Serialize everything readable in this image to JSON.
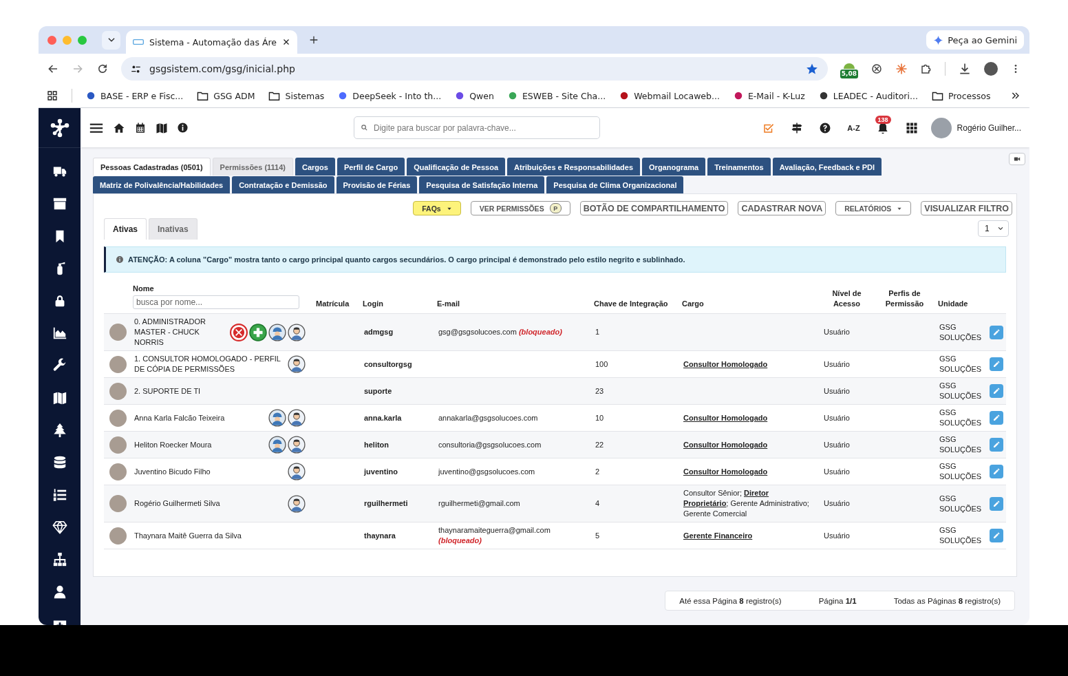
{
  "browser": {
    "tab_title": "Sistema - Automação das Áre",
    "gemini_button": "Peça ao Gemini",
    "url": "gsgsistem.com/gsg/inicial.php",
    "extension_badge": "5,08",
    "bookmarks": [
      {
        "label": "BASE - ERP e Fisc...",
        "kind": "site",
        "color": "#2b59c3"
      },
      {
        "label": "GSG ADM",
        "kind": "folder"
      },
      {
        "label": "Sistemas",
        "kind": "folder"
      },
      {
        "label": "DeepSeek - Into th...",
        "kind": "site",
        "color": "#4d6bfe"
      },
      {
        "label": "Qwen",
        "kind": "site",
        "color": "#6b4ce6"
      },
      {
        "label": "ESWEB - Site Cha...",
        "kind": "site",
        "color": "#3aa757"
      },
      {
        "label": "Webmail Locaweb...",
        "kind": "site",
        "color": "#b5121b"
      },
      {
        "label": "E-Mail - K-Luz",
        "kind": "site",
        "color": "#c2185b"
      },
      {
        "label": "LEADEC - Auditori...",
        "kind": "site",
        "color": "#333333"
      },
      {
        "label": "Processos",
        "kind": "folder"
      }
    ]
  },
  "header": {
    "search_placeholder": "Digite para buscar por palavra-chave...",
    "shortcut": "A-Z",
    "notifications": "138",
    "user_name": "Rogério Guilher..."
  },
  "tab_rows": [
    [
      {
        "label": "Pessoas Cadastradas  (0501)",
        "kind": "light",
        "selected": true
      },
      {
        "label": "Permissões (1114)",
        "kind": "light",
        "selected": false
      },
      {
        "label": "Cargos",
        "kind": "dark",
        "selected": false
      },
      {
        "label": "Perfil de Cargo",
        "kind": "dark",
        "selected": false
      },
      {
        "label": "Qualificação de Pessoa",
        "kind": "dark",
        "selected": false
      },
      {
        "label": "Atribuições e Responsabilidades",
        "kind": "dark",
        "selected": false
      },
      {
        "label": "Organograma",
        "kind": "dark",
        "selected": false
      },
      {
        "label": "Treinamentos",
        "kind": "dark",
        "selected": false
      },
      {
        "label": "Avaliação, Feedback e PDI",
        "kind": "dark",
        "selected": false
      }
    ],
    [
      {
        "label": "Matriz de Polivalência/Habilidades",
        "kind": "dark",
        "selected": false
      },
      {
        "label": "Contratação e Demissão",
        "kind": "dark",
        "selected": false
      },
      {
        "label": "Provisão de Férias",
        "kind": "dark",
        "selected": false
      },
      {
        "label": "Pesquisa de Satisfação Interna",
        "kind": "dark",
        "selected": false
      },
      {
        "label": "Pesquisa de Clima Organizacional",
        "kind": "dark",
        "selected": false
      }
    ]
  ],
  "actions": [
    {
      "label": "FAQs",
      "kind": "faq"
    },
    {
      "label": "VER PERMISSÕES",
      "kind": "permissions",
      "badge": "P"
    },
    {
      "label": "BOTÃO DE COMPARTILHAMENTO",
      "kind": "plain"
    },
    {
      "label": "CADASTRAR NOVA",
      "kind": "plain"
    },
    {
      "label": "RELATÓRIOS",
      "kind": "menu"
    },
    {
      "label": "VISUALIZAR FILTRO",
      "kind": "plain"
    }
  ],
  "status_tabs": [
    {
      "label": "Ativas",
      "selected": true
    },
    {
      "label": "Inativas",
      "selected": false
    }
  ],
  "page_select": "1",
  "notice": "ATENÇÃO: A coluna \"Cargo\" mostra tanto o cargo principal quanto cargos secundários. O cargo principal é demonstrado pelo estilo negrito e sublinhado.",
  "table": {
    "name_filter_placeholder": "busca por nome...",
    "columns": [
      "Nome",
      "Matrícula",
      "Login",
      "E-mail",
      "Chave de Integração",
      "Cargo",
      "Nível de Acesso",
      "Perfis de Permissão",
      "Unidade"
    ],
    "rows": [
      {
        "name": "0. ADMINISTRADOR MASTER - CHUCK NORRIS",
        "badges": [
          {
            "kind": "brigade"
          },
          {
            "kind": "first-aid"
          },
          {
            "kind": "engineer"
          },
          {
            "kind": "consultant"
          }
        ],
        "login": "admgsg",
        "email": "gsg@gsgsolucoes.com",
        "email_note": "(bloqueado)",
        "key": "1",
        "level": "Usuário",
        "unit": "GSG SOLUÇÕES"
      },
      {
        "name": "1. CONSULTOR HOMOLOGADO - PERFIL DE CÓPIA DE PERMISSÕES",
        "badges": [
          {
            "kind": "consultant"
          }
        ],
        "login": "consultorgsg",
        "key": "100",
        "cargo": {
          "text": "Consultor Homologado",
          "principal": true
        },
        "level": "Usuário",
        "unit": "GSG SOLUÇÕES"
      },
      {
        "name": "2. SUPORTE DE TI",
        "badges": [],
        "login": "suporte",
        "key": "23",
        "level": "Usuário",
        "unit": "GSG SOLUÇÕES"
      },
      {
        "name": "Anna Karla Falcão Teixeira",
        "badges": [
          {
            "kind": "engineer"
          },
          {
            "kind": "consultant"
          }
        ],
        "login": "anna.karla",
        "email": "annakarla@gsgsolucoes.com",
        "key": "10",
        "cargo": {
          "text": "Consultor Homologado",
          "principal": true
        },
        "level": "Usuário",
        "unit": "GSG SOLUÇÕES"
      },
      {
        "name": "Heliton Roecker Moura",
        "badges": [
          {
            "kind": "engineer"
          },
          {
            "kind": "consultant"
          }
        ],
        "login": "heliton",
        "email": "consultoria@gsgsolucoes.com",
        "key": "22",
        "cargo": {
          "text": "Consultor Homologado",
          "principal": true
        },
        "level": "Usuário",
        "unit": "GSG SOLUÇÕES"
      },
      {
        "name": "Juventino Bicudo Filho",
        "badges": [
          {
            "kind": "consultant"
          }
        ],
        "login": "juventino",
        "email": "juventino@gsgsolucoes.com",
        "key": "2",
        "cargo": {
          "text": "Consultor Homologado",
          "principal": true
        },
        "level": "Usuário",
        "unit": "GSG SOLUÇÕES"
      },
      {
        "name": "Rogério Guilhermeti Silva",
        "badges": [
          {
            "kind": "consultant"
          }
        ],
        "login": "rguilhermeti",
        "email": "rguilhermeti@gmail.com",
        "key": "4",
        "cargo": {
          "text": "Consultor Sênior; **Diretor Proprietário**; Gerente Administrativo; Gerente Comercial",
          "principal": false
        },
        "level": "Usuário",
        "unit": "GSG SOLUÇÕES"
      },
      {
        "name": "Thaynara Maitê Guerra da Silva",
        "badges": [],
        "login": "thaynara",
        "email": "thaynaramaiteguerra@gmail.com",
        "email_note": "(bloqueado)",
        "key": "5",
        "cargo": {
          "text": "Gerente Financeiro",
          "principal": true
        },
        "level": "Usuário",
        "unit": "GSG SOLUÇÕES"
      }
    ]
  },
  "footer": [
    "Até essa Página **8** registro(s)",
    "Página **1/1**",
    "Todas as Páginas **8** registro(s)"
  ]
}
